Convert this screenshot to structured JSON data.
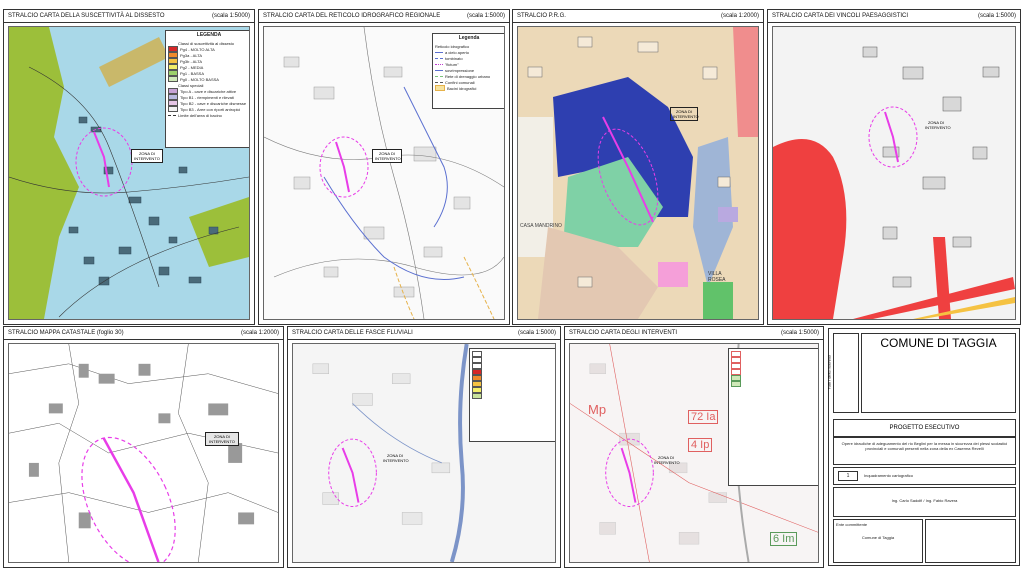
{
  "panels": [
    {
      "title": "STRALCIO CARTA DELLA SUSCETTIVITÀ AL  DISSESTO",
      "scale": "(scala 1:5000)"
    },
    {
      "title": "STRALCIO CARTA DEL RETICOLO IDROGRAFICO REGIONALE",
      "scale": "(scala 1:5000)"
    },
    {
      "title": "STRALCIO P.R.G.",
      "scale": "(scala 1:2000)"
    },
    {
      "title": "STRALCIO CARTA DEI VINCOLI PAESAGGISTICI",
      "scale": "(scala 1:5000)"
    },
    {
      "title": "STRALCIO MAPPA CATASTALE  (foglio 30)",
      "scale": "(scala 1:2000)"
    },
    {
      "title": "STRALCIO CARTA DELLE FASCE FLUVIALI",
      "scale": "(scala 1:5000)"
    },
    {
      "title": "STRALCIO CARTA DEGLI INTERVENTI",
      "scale": "(scala 1:5000)"
    }
  ],
  "legend1": {
    "title": "LEGENDA",
    "items": [
      "Classi di suscettività al dissesto",
      "Pg4 - MOLTO ALTA",
      "Pg3a - ALTA",
      "Pg3b - ALTA",
      "Pg2 - MEDIA",
      "Pg1 - BASSA",
      "Pg0 - MOLTO BASSA",
      "Classi speciali",
      "Tipo A - cave e discariche attive",
      "Tipo B1 - riempimenti e rilevati",
      "Tipo B2 - cave e discariche dismesse",
      "Tipo B3 - Aree con riporti antropici",
      "Limite dell'area di bacino"
    ],
    "colors": [
      "#ffffff",
      "#d62728",
      "#f08a2c",
      "#f5c242",
      "#f3ee6a",
      "#9cd06b",
      "#cfe8b8",
      "#ffffff",
      "#c7a3d6",
      "#b9b9e0",
      "#e6c6e6",
      "#f2f2f2",
      "#ffffff"
    ]
  },
  "legend2": {
    "title": "Legenda",
    "items": [
      "Reticolo idrografico",
      "a cielo aperto",
      "tombinato",
      "\"fictum\"",
      "sovrimpressione",
      "Rete di drenaggio urbano",
      "Confini comunali",
      "Bacini idrografici"
    ]
  },
  "callouts": {
    "zona": "ZONA DI INTERVENTO",
    "casa_mandrino": "CASA MANDRINO",
    "villa_rosea": "VILLA ROSEA",
    "mp": "Mp",
    "z72": "72 Ia",
    "z4": "4 Ip",
    "z6": "6 Im"
  },
  "title_block": {
    "commune": "COMUNE DI TAGGIA",
    "project": "PROGETTO ESECUTIVO",
    "description": "Opere idrauliche di adeguamento del rio Beglini per la messa in sicurezza dei plessi scolastici provinciali e comunali presenti nella zona della ex Caserma Revelli",
    "sheet_number": "1",
    "sheet_title": "Inquadramento cartografico",
    "designer": "Ing. Carlo Sadolfi / Ing. Fabio Ravera",
    "client_label": "Ente committente",
    "client": "Comune di Taggia",
    "side_label": "Tutti i diritti riservati"
  }
}
